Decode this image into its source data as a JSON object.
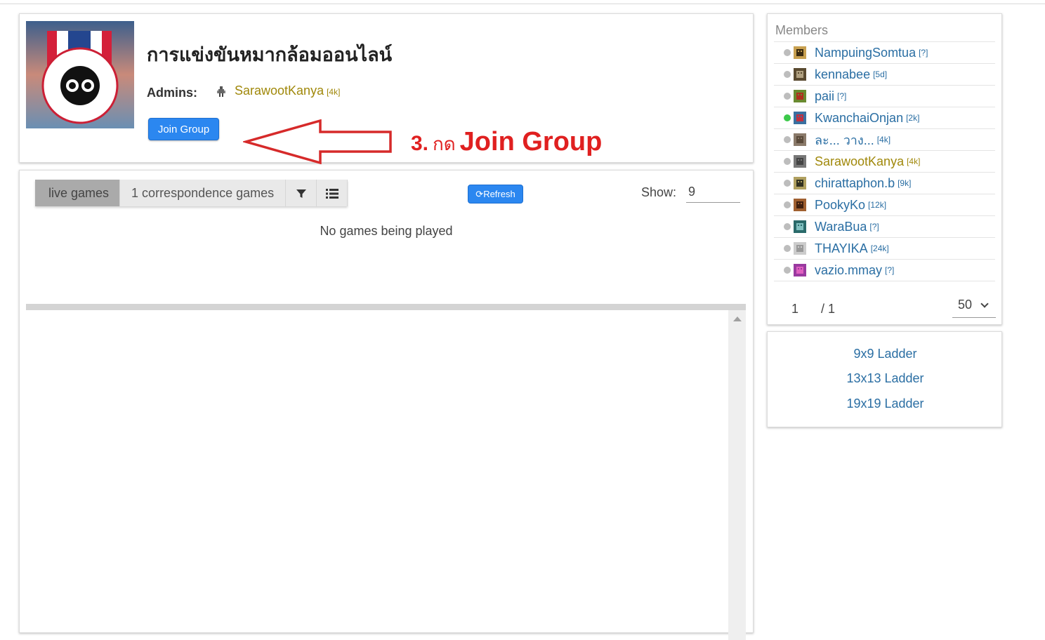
{
  "group": {
    "title": "การแข่งขันหมากล้อมออนไลน์",
    "logo_alt": "Go Association of Thailand logo",
    "admins_label": "Admins:",
    "admin": {
      "name": "SarawootKanya",
      "rank": "[4k]"
    },
    "join_label": "Join Group"
  },
  "annotation": {
    "number": "3.",
    "thai": "กด",
    "text": "Join Group",
    "color": "#e02020"
  },
  "games": {
    "tabs": [
      "live games",
      "1 correspondence games"
    ],
    "filter_icon": "filter-icon",
    "list_icon": "list-icon",
    "refresh_label": "Refresh",
    "show_label": "Show:",
    "show_value": "9",
    "empty_text": "No games being played"
  },
  "members": {
    "title": "Members",
    "items": [
      {
        "name": "NampuingSomtua",
        "rank": "[?]",
        "online": false
      },
      {
        "name": "kennabee",
        "rank": "[5d]",
        "online": false
      },
      {
        "name": "paii",
        "rank": "[?]",
        "online": false
      },
      {
        "name": "KwanchaiOnjan",
        "rank": "[2k]",
        "online": true
      },
      {
        "name": "ละ... วาง...",
        "rank": "[4k]",
        "online": false
      },
      {
        "name": "SarawootKanya",
        "rank": "[4k]",
        "online": false,
        "admin": true
      },
      {
        "name": "chirattaphon.b",
        "rank": "[9k]",
        "online": false
      },
      {
        "name": "PookyKo",
        "rank": "[12k]",
        "online": false
      },
      {
        "name": "WaraBua",
        "rank": "[?]",
        "online": false
      },
      {
        "name": "THAYIKA",
        "rank": "[24k]",
        "online": false
      },
      {
        "name": "vazio.mmay",
        "rank": "[?]",
        "online": false
      }
    ],
    "page_current": "1",
    "page_total": "/ 1",
    "page_size": "50"
  },
  "ladders": [
    "9x9 Ladder",
    "13x13 Ladder",
    "19x19 Ladder"
  ],
  "colors": {
    "accent": "#2b87f0",
    "link": "#2a6ea3",
    "admin": "#a0880a"
  }
}
